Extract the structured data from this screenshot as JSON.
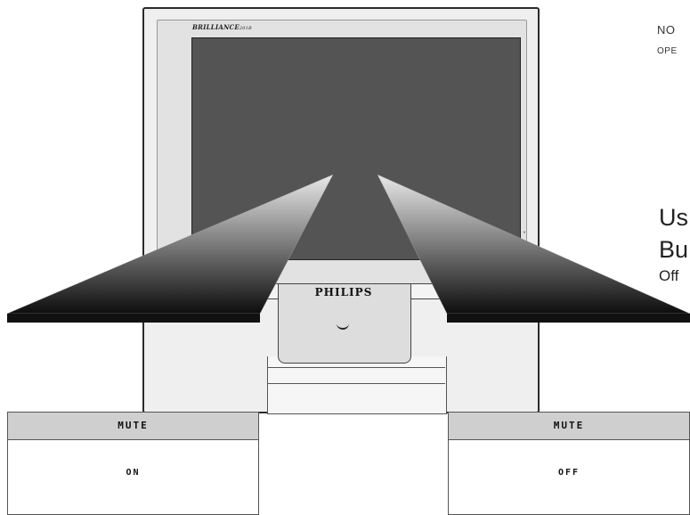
{
  "monitor": {
    "brand_logo": "BRILLIANCE",
    "brand_logo_suffix": "201B",
    "brand_name": "PHILIPS",
    "power_icon": "power-button-icon"
  },
  "note": {
    "title": "NO",
    "subtitle": "OPE"
  },
  "instructions": {
    "line1": "Us",
    "line2": "Bu",
    "line3": "Off"
  },
  "osd_left": {
    "header": "MUTE",
    "value": "ON"
  },
  "osd_right": {
    "header": "MUTE",
    "value": "OFF"
  },
  "colors": {
    "screen": "#545454",
    "panel_header": "#cfcfcf",
    "beam_dark": "#111111",
    "beam_light": "#e8e8e8"
  }
}
